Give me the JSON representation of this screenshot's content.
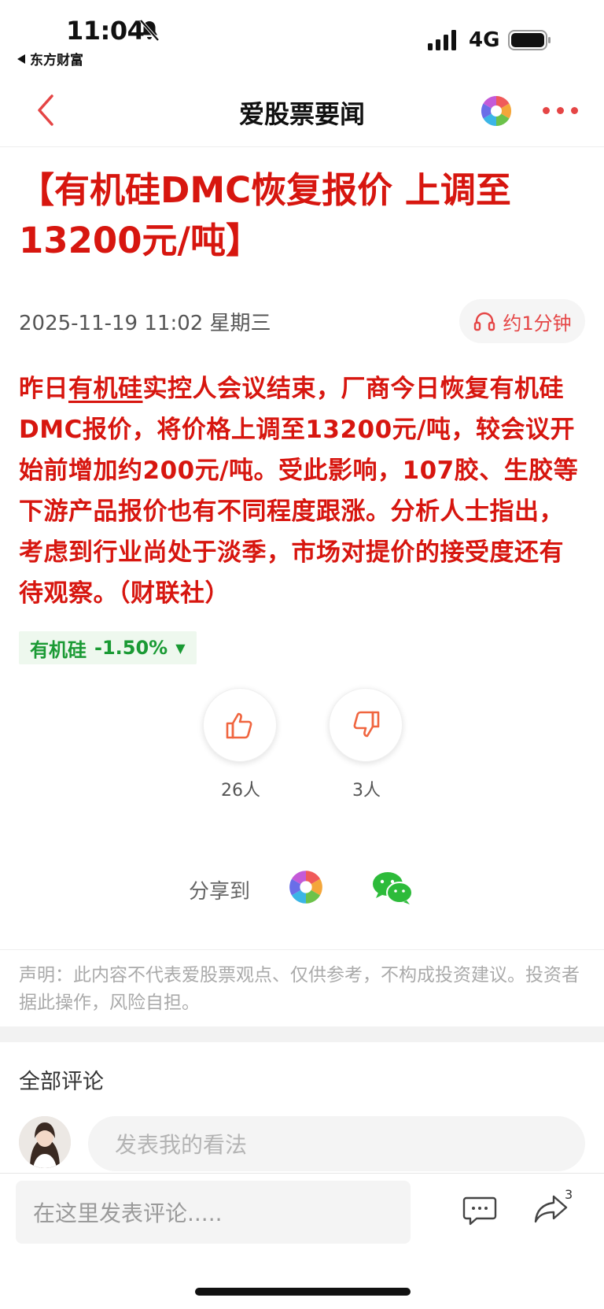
{
  "status_bar": {
    "time": "11:04",
    "back_app": "东方财富",
    "network": "4G"
  },
  "header": {
    "title": "爱股票要闻"
  },
  "article": {
    "title": "【有机硅DMC恢复报价 上调至13200元/吨】",
    "date": "2025-11-19 11:02 星期三",
    "listen_label": "约1分钟",
    "body_prefix": "昨日",
    "body_keyword": "有机硅",
    "body_rest": "实控人会议结束，厂商今日恢复有机硅DMC报价，将价格上调至13200元/吨，较会议开始前增加约200元/吨。受此影响，107胶、生胶等下游产品报价也有不同程度跟涨。分析人士指出，考虑到行业尚处于淡季，市场对提价的接受度还有待观察。（财联社）",
    "stock_tag": {
      "name": "有机硅",
      "change": "-1.50%",
      "direction_symbol": "▼"
    }
  },
  "votes": {
    "up_count": "26人",
    "down_count": "3人"
  },
  "share": {
    "label": "分享到"
  },
  "disclaimer": "声明：此内容不代表爱股票观点、仅供参考，不构成投资建议。投资者据此操作，风险自担。",
  "comments": {
    "title": "全部评论",
    "input_placeholder": "发表我的看法"
  },
  "bottom_bar": {
    "input_placeholder": "在这里发表评论.....",
    "share_count": "3"
  },
  "colors": {
    "accent_red": "#d7160f",
    "stock_down_green": "#1a9a34"
  }
}
